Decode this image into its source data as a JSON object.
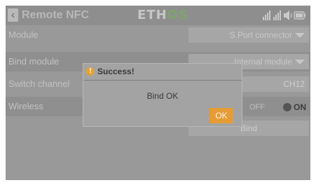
{
  "header": {
    "back_icon": "chevron-left-icon",
    "title": "Remote NFC",
    "logo_part1": "ETH",
    "logo_part2": "OS",
    "status_icons": [
      "signal-icon",
      "signal-icon",
      "speaker-icon",
      "battery-icon"
    ]
  },
  "rows": {
    "module": {
      "label": "Module",
      "value": "S.Port connector"
    },
    "bind_module": {
      "label": "Bind module",
      "value": "Internal module"
    },
    "switch_channel": {
      "label": "Switch channel",
      "value": "CH12"
    },
    "wireless": {
      "label": "Wireless",
      "off_label": "OFF",
      "on_label": "ON"
    }
  },
  "bind_button": {
    "label": "Bind"
  },
  "dialog": {
    "icon": "alert-icon",
    "title": "Success!",
    "message": "Bind OK",
    "ok_label": "OK",
    "accent_color": "#e69c34"
  }
}
